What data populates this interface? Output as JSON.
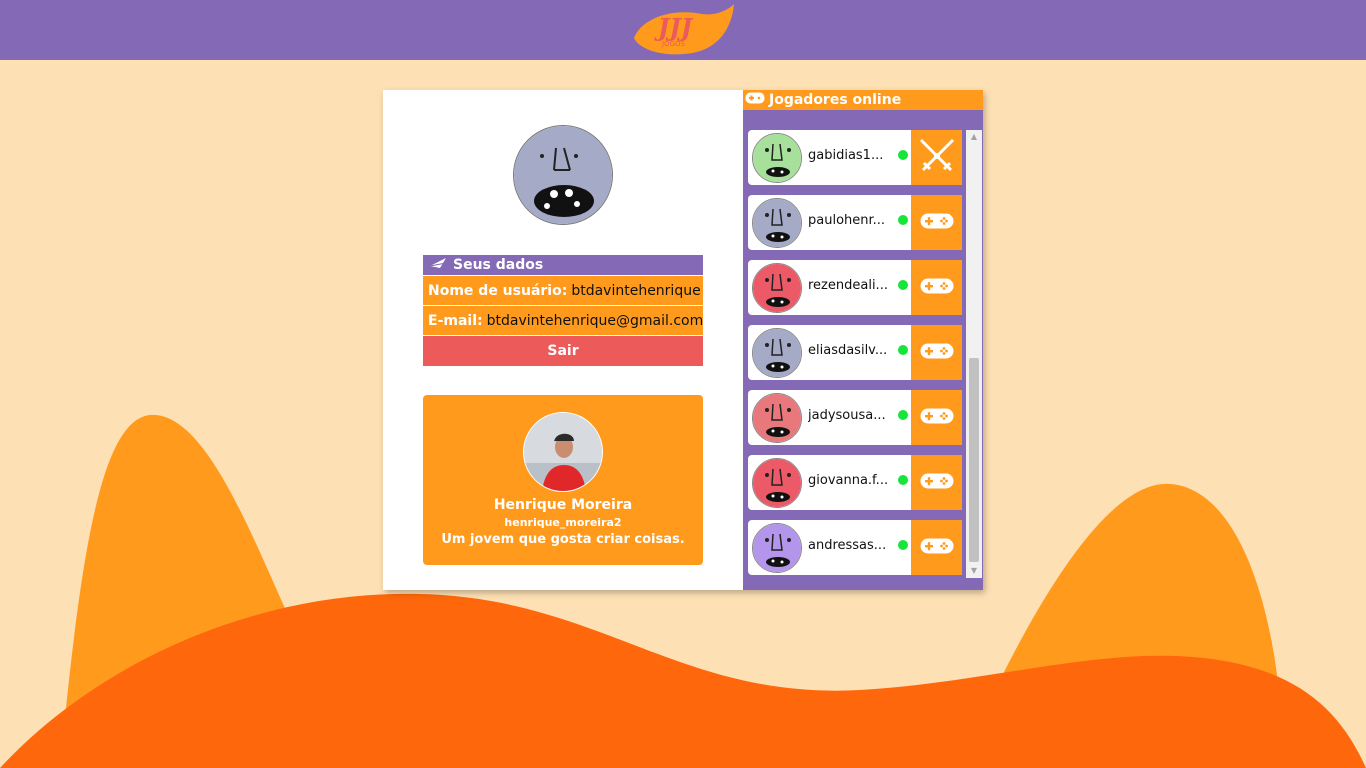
{
  "logo": {
    "alt": "JJJ logo"
  },
  "user_panel": {
    "title": "Seus dados",
    "username_label": "Nome de usuário:",
    "username_value": "btdavintehenrique",
    "email_label": "E-mail:",
    "email_value": "btdavintehenrique@gmail.com",
    "logout_label": "Sair"
  },
  "profile": {
    "name": "Henrique Moreira",
    "handle": "henrique_moreira2",
    "bio": "Um jovem que gosta criar coisas."
  },
  "online": {
    "title": "Jogadores online",
    "players": [
      {
        "name": "gabidias1...",
        "color": "#a6e09a",
        "action": "swords-icon"
      },
      {
        "name": "paulohenr...",
        "color": "#a5aac7",
        "action": "gamepad-icon"
      },
      {
        "name": "rezendeali...",
        "color": "#ec5a68",
        "action": "gamepad-icon"
      },
      {
        "name": "eliasdasilv...",
        "color": "#a5aac7",
        "action": "gamepad-icon"
      },
      {
        "name": "jadysousa...",
        "color": "#e8787b",
        "action": "gamepad-icon"
      },
      {
        "name": "giovanna.f...",
        "color": "#ec5a68",
        "action": "gamepad-icon"
      },
      {
        "name": "andressas...",
        "color": "#b395ec",
        "action": "gamepad-icon"
      }
    ]
  },
  "colors": {
    "purple": "#8469b6",
    "orange": "#ff9a1d",
    "red": "#ec5a59",
    "background": "#fde0b4",
    "online_dot": "#17e53a"
  }
}
